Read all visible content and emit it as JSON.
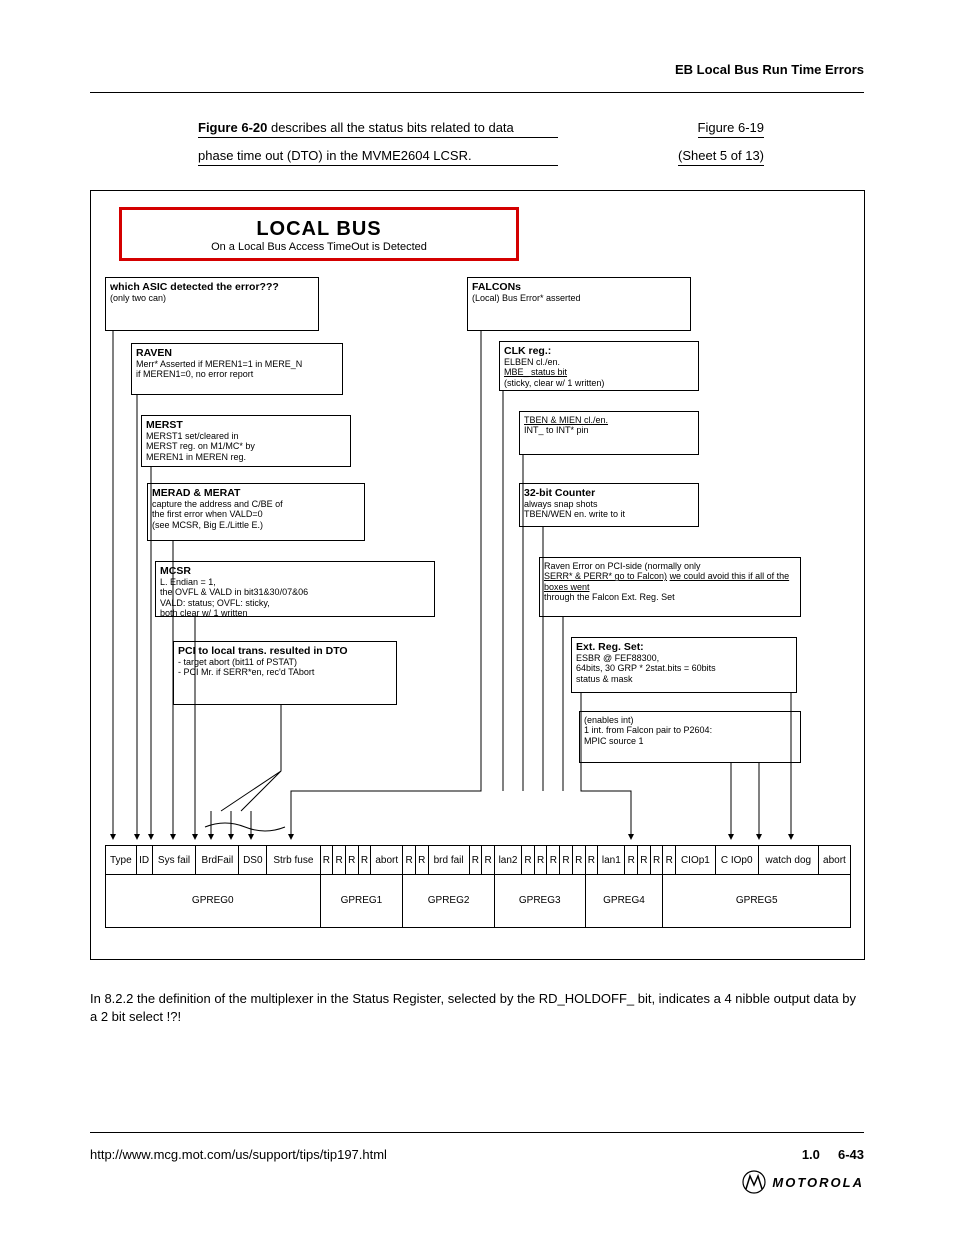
{
  "header_right": "EB Local Bus Run Time Errors",
  "fig_caption_main_bold": "Figure 6-20",
  "fig_caption_main_rest": " describes all the status bits related to data",
  "fig_caption_main_line2": "phase time out (DTO) in the MVME2604 LCSR.",
  "fig_caption_right_1": "Figure 6-19",
  "fig_caption_right_2": "(Sheet 5 of 13)",
  "diagram_title_big": "LOCAL BUS",
  "diagram_title_sub": "On a Local Bus Access TimeOut is Detected",
  "left_heading": "which ASIC detected the error???",
  "left_heading_sub": "(only two can)",
  "boxes_left": [
    {
      "title": "RAVEN",
      "line1": "Merr* Asserted if MEREN1=1 in MERE_N",
      "line2": "if MEREN1=0, no error report"
    },
    {
      "title": "MERST",
      "line1": "MERST1 set/cleared in",
      "line2": "MERST reg. on M1/MC* by",
      "line3": "MEREN1 in MEREN reg."
    },
    {
      "title": "MERAD & MERAT",
      "line1": "capture the address and C/BE of",
      "line2": "the first error when VALD=0",
      "line3": "(see MCSR, Big E./Little E.)"
    },
    {
      "title": "MCSR",
      "line1": "L. Endian = 1,",
      "line2": "the OVFL & VALD in bit31&30/07&06",
      "line3": "VALD: status; OVFL: sticky,",
      "line4": "both clear w/ 1 written"
    },
    {
      "title": "PCI to local trans. resulted in DTO",
      "line1": "- target abort (bit11 of PSTAT)",
      "line2": "- PCI Mr. if SERR*en, rec'd TAbort"
    }
  ],
  "right_heading": "FALCONs",
  "right_heading_sub": "(Local) Bus Error* asserted",
  "boxes_right": [
    {
      "title": "CLK reg.:",
      "line1": "ELBEN cl./en.",
      "line2": "MBE_ status bit",
      "line3": "(sticky, clear w/ 1 written)"
    },
    {
      "title": "",
      "line1": "TBEN & MIEN cl./en.",
      "line2": "INT_ to INT* pin"
    },
    {
      "title": "32-bit Counter",
      "line1": "always snap shots",
      "line2": "TBEN/WEN en. write to it"
    },
    {
      "title": "Raven Error on PCI-side (normally only",
      "line1": "SERR* & PERR* go to Falcon)",
      "line2": "we could avoid this if all of the boxes went",
      "line3": "through the Falcon Ext. Reg. Set"
    },
    {
      "title": "Ext. Reg. Set:",
      "line1": "ESBR @ FEF88300,",
      "line2": "64bits, 30 GRP * 2stat.bits = 60bits",
      "line3": "status & mask"
    },
    {
      "title": "(enables int)",
      "line1": "1 int. from Falcon pair to P2604:",
      "line2": "MPIC source 1"
    }
  ],
  "bar_cells": [
    "Type",
    "ID",
    "Sys fail",
    "BrdFail",
    "DS0",
    "Strb fuse",
    "R",
    "R",
    "R",
    "R",
    "abort",
    "R",
    "R",
    "brd fail",
    "R",
    "R",
    "lan2",
    "R",
    "R",
    "R",
    "R",
    "R",
    "R",
    "lan1",
    "R",
    "R",
    "R",
    "R",
    "CIOp1",
    "C IOp0",
    "watch dog",
    "abort"
  ],
  "bar_labels": [
    "GPREG0",
    "GPREG1",
    "GPREG2",
    "GPREG3",
    "GPREG4",
    "GPREG5"
  ],
  "paragraph": "In 8.2.2 the definition of the multiplexer in the Status Register, selected by the RD_HOLDOFF_ bit, indicates a 4 nibble output data by a 2 bit select !?!",
  "footer_left": "http://www.mcg.mot.com/us/support/tips/tip197.html",
  "footer_rev": "1.0",
  "footer_page": "6-43"
}
